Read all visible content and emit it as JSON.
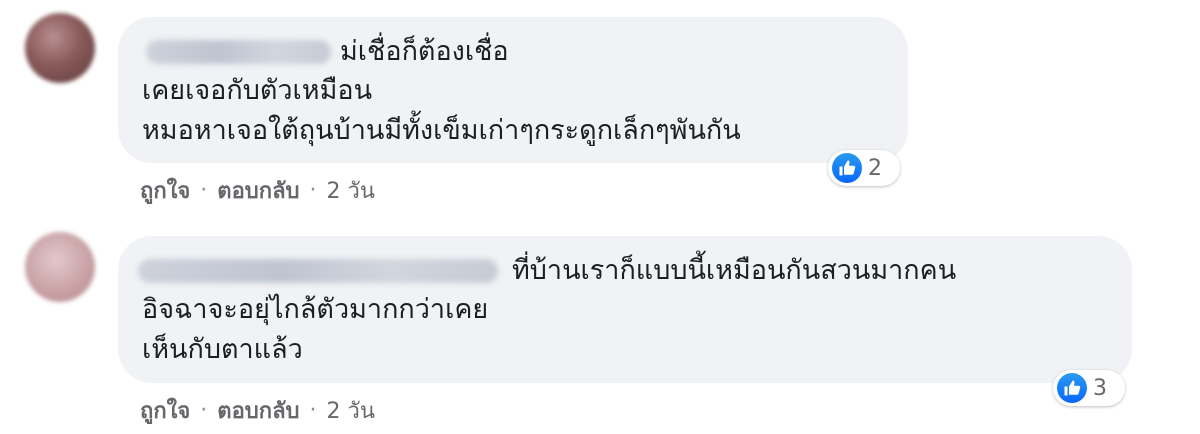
{
  "comments": [
    {
      "text_lines": [
        "ม่เชื่อก็ต้องเชื่อ",
        "เคยเจอกับตัวเหมือน",
        "หมอหาเจอใต้ถุนบ้านมีทั้งเข็มเก่าๆกระดูกเล็กๆพันกัน"
      ],
      "reaction_count": "2",
      "actions": {
        "like": "ถูกใจ",
        "reply": "ตอบกลับ",
        "time": "2 วัน",
        "separator": "·"
      }
    },
    {
      "text_lines": [
        "ที่บ้านเราก็แบบนี้เหมือนกันสวนมากคน",
        "อิจฉาจะอยุ่ไกล้ตัวมากกว่าเคย",
        "เห็นกับตาแล้ว"
      ],
      "reaction_count": "3",
      "actions": {
        "like": "ถูกใจ",
        "reply": "ตอบกลับ",
        "time": "2 วัน",
        "separator": "·"
      }
    }
  ],
  "icons": {
    "reaction": "like-thumbs-up-icon",
    "avatar": "user-avatar"
  },
  "colors": {
    "bubble": "#f0f2f5",
    "meta_text": "#65676b",
    "like_blue": "#0866ff"
  }
}
